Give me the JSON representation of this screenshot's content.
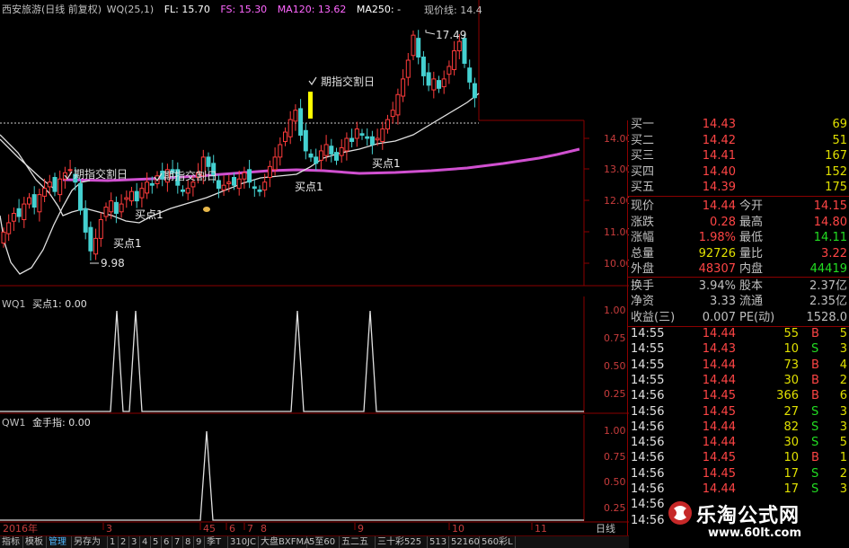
{
  "header": {
    "stock": "西安旅游(日线 前复权)",
    "wq": "WQ(25,1)",
    "fl": "FL: 15.70",
    "fs": "FS: 15.30",
    "ma120": "MA120: 13.62",
    "ma250": "MA250: -",
    "price_label": "现价线: 14.4"
  },
  "colors": {
    "up": "#ff3c3c",
    "down": "#44d0d0",
    "ma120": "#d050d0",
    "curve": "#e0e0e0",
    "accent_yellow": "#ffff00",
    "axis": "#8b0000",
    "green": "#22dd22"
  },
  "main_labels": {
    "peak": "17.49",
    "low": "9.98",
    "qizhi1": "期指交割日",
    "qizhi2": "期指交割日",
    "qizhi3": "期指交割日",
    "buy1": "买点1",
    "buy2": "买点1",
    "buy3": "买点1",
    "buy4": "买点1"
  },
  "price_axis": [
    "14.00",
    "13.00",
    "12.00",
    "11.00",
    "10.00"
  ],
  "wq1": {
    "label": "WQ1",
    "title": "买点1: 0.00",
    "ticks": [
      "1.00",
      "0.75",
      "0.50",
      "0.25"
    ]
  },
  "qw1": {
    "label": "QW1",
    "title": "金手指: 0.00",
    "ticks": [
      "1.00",
      "0.75",
      "0.50",
      "0.25"
    ]
  },
  "date_axis": {
    "year": "2016年",
    "months": [
      "3",
      "4",
      "5",
      "6",
      "7",
      "8",
      "9",
      "10",
      "11"
    ],
    "period": "日线"
  },
  "quote": {
    "bids": [
      {
        "name": "买一",
        "price": "14.43",
        "vol": "69"
      },
      {
        "name": "买二",
        "price": "14.42",
        "vol": "51"
      },
      {
        "name": "买三",
        "price": "14.41",
        "vol": "167"
      },
      {
        "name": "买四",
        "price": "14.40",
        "vol": "152"
      },
      {
        "name": "买五",
        "price": "14.39",
        "vol": "175"
      }
    ],
    "stats": [
      {
        "l1": "现价",
        "v1": "14.44",
        "l2": "今开",
        "v2": "14.15"
      },
      {
        "l1": "涨跌",
        "v1": "0.28",
        "l2": "最高",
        "v2": "14.80"
      },
      {
        "l1": "涨幅",
        "v1": "1.98%",
        "l2": "最低",
        "v2": "14.11"
      },
      {
        "l1": "总量",
        "v1": "92726",
        "l2": "量比",
        "v2": "3.22"
      },
      {
        "l1": "外盘",
        "v1": "48307",
        "l2": "内盘",
        "v2": "44419"
      }
    ],
    "fin": [
      {
        "l1": "换手",
        "v1": "3.94%",
        "l2": "股本",
        "v2": "2.37亿"
      },
      {
        "l1": "净资",
        "v1": "3.33",
        "l2": "流通",
        "v2": "2.35亿"
      },
      {
        "l1": "收益(三)",
        "v1": "0.007",
        "l2": "PE(动)",
        "v2": "1528.0"
      }
    ],
    "ticks": [
      {
        "t": "14:55",
        "p": "14.44",
        "v": "55",
        "s": "B",
        "n": "5"
      },
      {
        "t": "14:55",
        "p": "14.43",
        "v": "10",
        "s": "S",
        "n": "3"
      },
      {
        "t": "14:55",
        "p": "14.44",
        "v": "73",
        "s": "B",
        "n": "4"
      },
      {
        "t": "14:55",
        "p": "14.44",
        "v": "30",
        "s": "B",
        "n": "2"
      },
      {
        "t": "14:56",
        "p": "14.45",
        "v": "366",
        "s": "B",
        "n": "6"
      },
      {
        "t": "14:56",
        "p": "14.45",
        "v": "27",
        "s": "S",
        "n": "3"
      },
      {
        "t": "14:56",
        "p": "14.44",
        "v": "82",
        "s": "S",
        "n": "3"
      },
      {
        "t": "14:56",
        "p": "14.44",
        "v": "30",
        "s": "S",
        "n": "5"
      },
      {
        "t": "14:56",
        "p": "14.45",
        "v": "10",
        "s": "B",
        "n": "1"
      },
      {
        "t": "14:56",
        "p": "14.45",
        "v": "17",
        "s": "S",
        "n": "2"
      },
      {
        "t": "14:56",
        "p": "14.44",
        "v": "17",
        "s": "S",
        "n": "3"
      },
      {
        "t": "14:56",
        "p": "",
        "v": "",
        "s": "",
        "n": ""
      },
      {
        "t": "14:56",
        "p": "",
        "v": "",
        "s": "",
        "n": ""
      }
    ]
  },
  "tabs": [
    "指标",
    "模板",
    "管理",
    "另存为",
    "1",
    "2",
    "3",
    "4",
    "5",
    "6",
    "7",
    "8",
    "9",
    "季T",
    "310JC",
    "大盘BXFMA",
    "5至60",
    "五二五",
    "三十彩525",
    "513",
    "52160",
    "560彩L"
  ],
  "watermark": {
    "name": "乐淘公式网",
    "url": "www.60lt.com"
  }
}
